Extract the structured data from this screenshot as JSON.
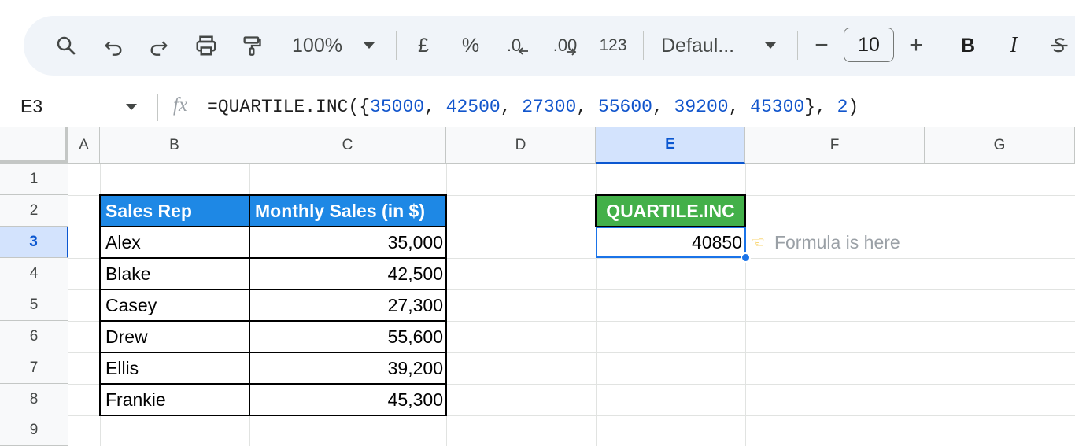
{
  "toolbar": {
    "zoom": "100%",
    "currency_symbol": "£",
    "percent_symbol": "%",
    "decrease_decimal": ".0",
    "increase_decimal": ".00",
    "number_format": "123",
    "font_name": "Defaul...",
    "font_size": "10",
    "minus": "−",
    "plus": "+",
    "bold": "B",
    "italic": "I"
  },
  "formula_bar": {
    "cell_ref": "E3",
    "fx": "fx",
    "formula_prefix": "=QUARTILE.INC({",
    "args": [
      "35000",
      "42500",
      "27300",
      "55600",
      "39200",
      "45300"
    ],
    "quartile_arg": "2",
    "formula_suffix": ")"
  },
  "columns": [
    "A",
    "B",
    "C",
    "D",
    "E",
    "F",
    "G"
  ],
  "rows": [
    "1",
    "2",
    "3",
    "4",
    "5",
    "6",
    "7",
    "8",
    "9"
  ],
  "table": {
    "header": [
      "Sales Rep",
      "Monthly Sales (in $)"
    ],
    "rows": [
      [
        "Alex",
        "35,000"
      ],
      [
        "Blake",
        "42,500"
      ],
      [
        "Casey",
        "27,300"
      ],
      [
        "Drew",
        "55,600"
      ],
      [
        "Ellis",
        "39,200"
      ],
      [
        "Frankie",
        "45,300"
      ]
    ]
  },
  "result": {
    "header": "QUARTILE.INC",
    "value": "40850",
    "note": "Formula is here",
    "note_icon": "pointing-hand-icon"
  },
  "colors": {
    "table_header": "#1e88e5",
    "result_header": "#43b049",
    "selection": "#1a73e8"
  }
}
